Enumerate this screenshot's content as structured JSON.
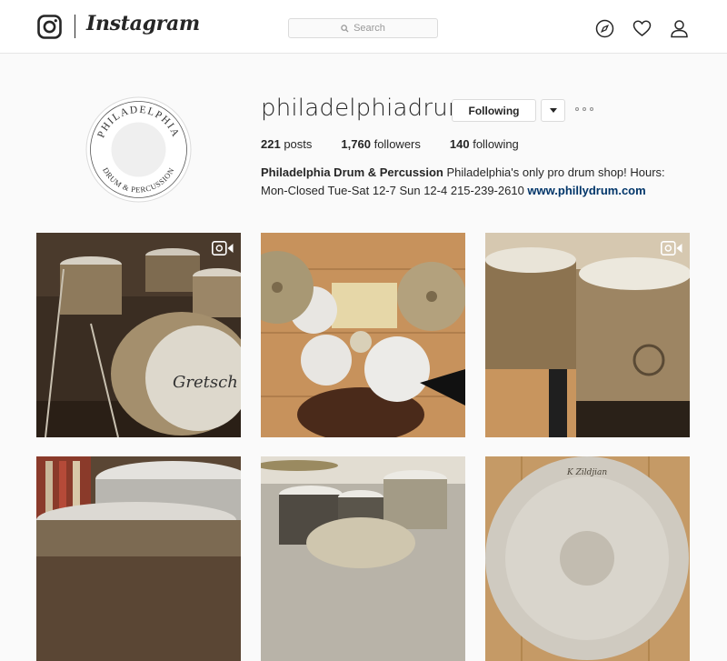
{
  "header": {
    "brand": "Instagram",
    "search_placeholder": "Search",
    "icons": [
      "instagram-glyph-icon",
      "search-icon",
      "compass-icon",
      "heart-icon",
      "person-icon"
    ]
  },
  "profile": {
    "username": "philadelphiadrum",
    "following_button": "Following",
    "avatar_text_top": "PHILADELPHIA",
    "avatar_text_bottom": "DRUM & PERCUSSION",
    "stats": {
      "posts_count": "221",
      "posts_label": "posts",
      "followers_count": "1,760",
      "followers_label": "followers",
      "following_count": "140",
      "following_label": "following"
    },
    "bio": {
      "name": "Philadelphia Drum & Percussion",
      "text": "Philadelphia's only pro drum shop! Hours: Mon-Closed Tue-Sat 12-7 Sun 12-4 215-239-2610",
      "link": "www.phillydrum.com"
    }
  },
  "posts": [
    {
      "subject": "gretsch-sparkle-drum-kit",
      "video": true
    },
    {
      "subject": "drum-kit-overhead-cymbals",
      "video": false
    },
    {
      "subject": "brass-snare-drums",
      "video": true
    },
    {
      "subject": "snare-drums-shop-shelf",
      "video": false
    },
    {
      "subject": "drum-kit-in-shop",
      "video": false
    },
    {
      "subject": "zildjian-cymbal",
      "video": false
    }
  ],
  "colors": {
    "background": "#fafafa",
    "text": "#262626",
    "link": "#003569",
    "border": "#dbdbdb"
  }
}
